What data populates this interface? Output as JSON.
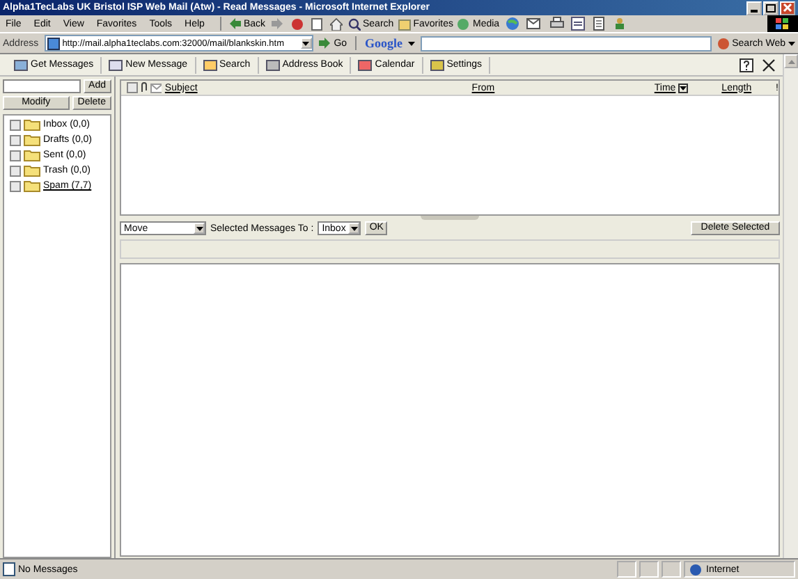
{
  "window": {
    "title": "Alpha1TecLabs UK Bristol ISP Web Mail (Atw) - Read Messages - Microsoft Internet Explorer"
  },
  "menu": [
    "File",
    "Edit",
    "View",
    "Favorites",
    "Tools",
    "Help"
  ],
  "browser_toolbar": {
    "back": "Back",
    "search": "Search",
    "favorites": "Favorites",
    "media": "Media"
  },
  "address_bar": {
    "label": "Address",
    "url": "http://mail.alpha1teclabs.com:32000/mail/blankskin.htm",
    "go": "Go"
  },
  "google_bar": {
    "logo": "Google",
    "search_button": "Search Web"
  },
  "mail_toolbar": [
    "Get Messages",
    "New Message",
    "Search",
    "Address Book",
    "Calendar",
    "Settings"
  ],
  "folder_panel": {
    "add": "Add",
    "modify": "Modify",
    "delete": "Delete",
    "folders": [
      {
        "name": "Inbox (0,0)",
        "checked": false,
        "kind": "plain"
      },
      {
        "name": "Drafts (0,0)",
        "checked": false,
        "kind": "plain"
      },
      {
        "name": "Sent (0,0)",
        "checked": false,
        "kind": "plain"
      },
      {
        "name": "Trash (0,0)",
        "checked": false,
        "kind": "plain"
      },
      {
        "name": "Spam (7,7)",
        "checked": false,
        "kind": "link"
      }
    ]
  },
  "message_list": {
    "select_all": {
      "checked": false
    },
    "columns": [
      "Subject",
      "From",
      "Time",
      "Length",
      "!"
    ]
  },
  "move_bar": {
    "action": "Move",
    "label": "Selected Messages To :",
    "target": "Inbox",
    "ok": "OK",
    "delete_selected": "Delete Selected"
  },
  "status_bar": {
    "text": "No Messages",
    "zone": "Internet"
  }
}
